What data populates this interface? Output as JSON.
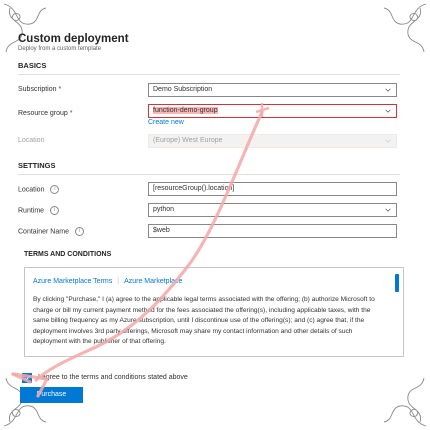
{
  "header": {
    "title": "Custom deployment",
    "subtitle": "Deploy from a custom template"
  },
  "basics": {
    "heading": "BASICS",
    "subscription": {
      "label": "Subscription",
      "required": "*",
      "value": "Demo Subscription"
    },
    "resource_group": {
      "label": "Resource group",
      "required": "*",
      "value": "function-demo-group",
      "create_new": "Create new"
    },
    "location": {
      "label": "Location",
      "value": "(Europe) West Europe"
    }
  },
  "settings": {
    "heading": "SETTINGS",
    "location": {
      "label": "Location",
      "value": "[resourceGroup().location]"
    },
    "runtime": {
      "label": "Runtime",
      "value": "python"
    },
    "container_name": {
      "label": "Container Name",
      "value": "$web"
    }
  },
  "terms": {
    "heading": "TERMS AND CONDITIONS",
    "link1": "Azure Marketplace Terms",
    "link2": "Azure Marketplace",
    "text": "By clicking \"Purchase,\" I (a) agree to the applicable legal terms associated with the offering; (b) authorize Microsoft to charge or bill my current payment method for the fees associated the offering(s), including applicable taxes, with the same billing frequency as my Azure subscription, until I discontinue use of the offering(s); and (c) agree that, if the deployment involves 3rd party offerings, Microsoft may share my contact information and other details of such deployment with the publisher of that offering.",
    "agree_label": "I agree to the terms and conditions stated above",
    "agree_checked": true
  },
  "actions": {
    "purchase_label": "Purchase"
  },
  "icons": {
    "info": "info-icon",
    "chevron": "chevron-down-icon",
    "check": "checkmark-icon"
  },
  "colors": {
    "accent": "#0078d4",
    "required": "#a4262c",
    "annotation_arrow": "#f4a8a8"
  }
}
